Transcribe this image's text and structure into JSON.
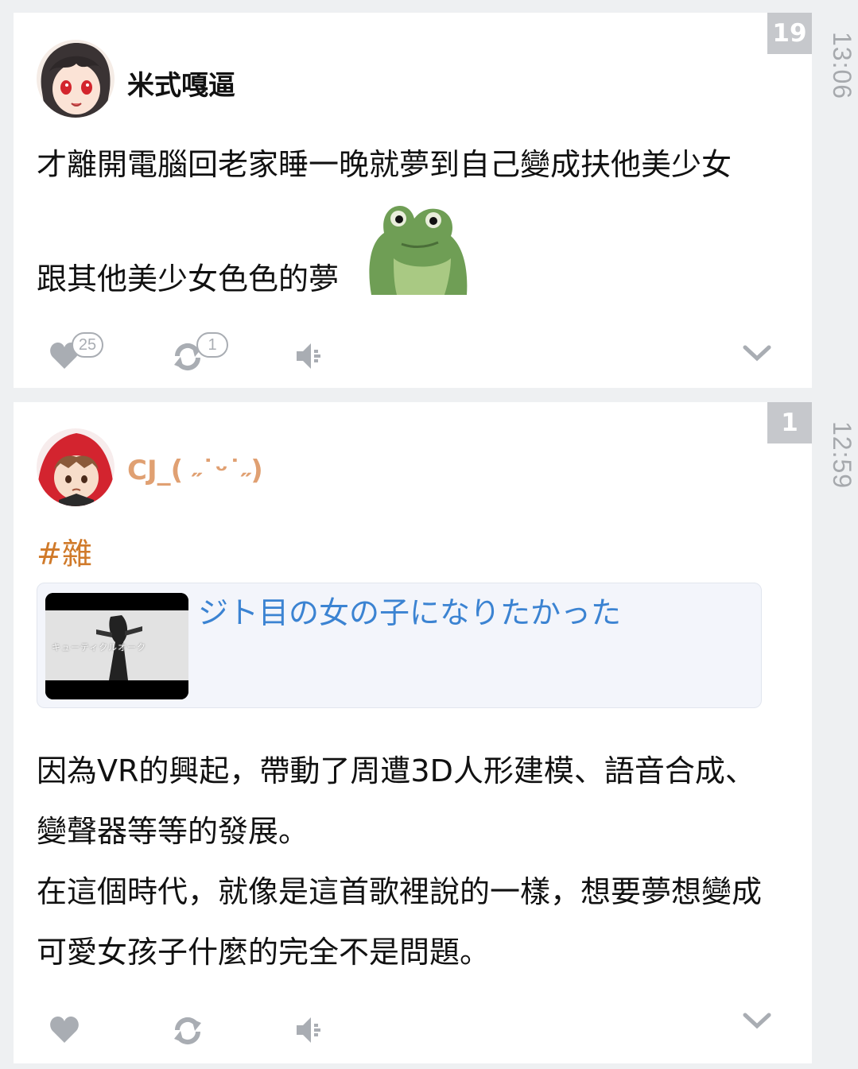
{
  "posts": [
    {
      "number": "19",
      "time": "13:06",
      "username": "米式嘎逼",
      "body_line1": "才離開電腦回老家睡一晚就夢到自己變成扶他美少女",
      "body_line2": "跟其他美少女色色的夢",
      "likes": "25",
      "reposts": "1"
    },
    {
      "number": "1",
      "time": "12:59",
      "username": "CJ_( ˶˙ᵕ˙˶)",
      "tag": "#雜",
      "link_title": "ジト目の女の子になりたかった",
      "thumb_caption": "キューティクルオーク",
      "paragraph1": "因為VR的興起，帶動了周遭3D人形建模、語音合成、變聲器等等的發展。",
      "paragraph2": "在這個時代，就像是這首歌裡說的一樣，想要夢想變成可愛女孩子什麼的完全不是問題。"
    }
  ],
  "icons": {
    "like": "heart-icon",
    "repost": "repost-icon",
    "read_aloud": "speaker-icon",
    "expand": "chevron-down-icon"
  },
  "colors": {
    "username2": "#e0a072",
    "tag": "#d07a2a",
    "link": "#3b83d2",
    "icon_gray": "#a9adb3",
    "badge_bg": "#c6c8cc"
  }
}
